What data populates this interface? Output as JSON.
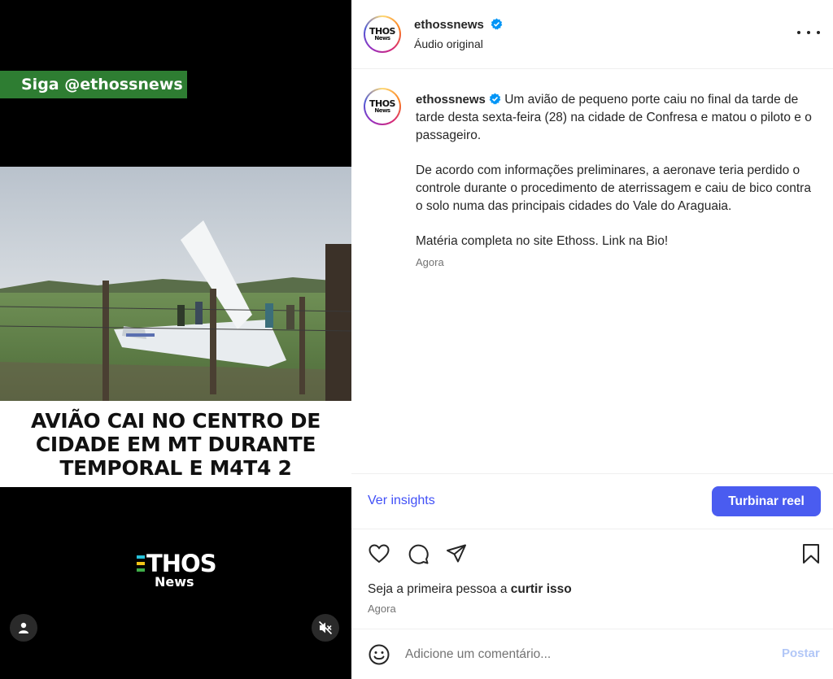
{
  "video": {
    "follow_banner": "Siga @ethossnews",
    "headline": "AVIÃO CAI NO CENTRO DE\nCIDADE EM MT DURANTE\nTEMPORAL E M4T4 2",
    "brand_name": "THOS",
    "brand_sub": "News",
    "icons": {
      "user": "user-icon",
      "mute": "speaker-muted-icon"
    }
  },
  "header": {
    "avatar_text": "THOS",
    "avatar_sub": "News",
    "username": "ethossnews",
    "audio_label": "Áudio original",
    "more_icon": "more-horizontal-icon"
  },
  "caption": {
    "username": "ethossnews",
    "paragraphs": [
      "Um avião de pequeno porte caiu no final da tarde de tarde desta sexta-feira (28) na cidade de Confresa e matou o piloto e o passageiro.",
      "De acordo com informações preliminares, a aeronave teria perdido o controle durante o procedimento de aterrissagem e caiu de bico contra o solo numa das principais cidades do Vale do Araguaia.",
      "Matéria completa no site Ethoss. Link na Bio!"
    ],
    "time": "Agora"
  },
  "insights": {
    "link_label": "Ver insights",
    "boost_label": "Turbinar reel"
  },
  "actions": {
    "icons": [
      "heart-icon",
      "comment-icon",
      "share-icon",
      "bookmark-icon"
    ],
    "likes_prefix": "Seja a primeira pessoa a ",
    "likes_link": "curtir isso",
    "time": "Agora"
  },
  "comment": {
    "placeholder": "Adicione um comentário...",
    "post_label": "Postar",
    "emoji_icon": "emoji-icon"
  },
  "colors": {
    "accent": "#4a5cf0",
    "link": "#4150f7",
    "banner": "#2e7d32",
    "verified": "#0095f6"
  }
}
